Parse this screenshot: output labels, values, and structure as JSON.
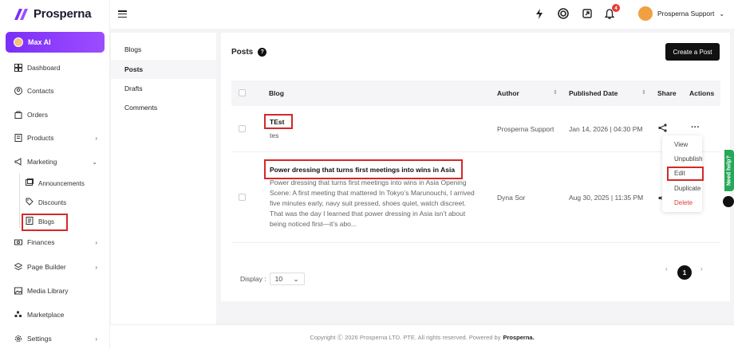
{
  "brand": {
    "name": "Prosperna",
    "accent": "#7b2ff7"
  },
  "sidebar": {
    "max_ai": "Max AI",
    "items": [
      {
        "label": "Dashboard",
        "icon": "dashboard-icon"
      },
      {
        "label": "Contacts",
        "icon": "contacts-icon"
      },
      {
        "label": "Orders",
        "icon": "orders-icon"
      },
      {
        "label": "Products",
        "icon": "products-icon"
      },
      {
        "label": "Marketing",
        "icon": "marketing-icon"
      },
      {
        "label": "Finances",
        "icon": "finances-icon"
      },
      {
        "label": "Page Builder",
        "icon": "page-builder-icon"
      },
      {
        "label": "Media Library",
        "icon": "media-library-icon"
      },
      {
        "label": "Marketplace",
        "icon": "marketplace-icon"
      },
      {
        "label": "Settings",
        "icon": "settings-icon"
      }
    ],
    "marketing_sub": [
      {
        "label": "Announcements"
      },
      {
        "label": "Discounts"
      },
      {
        "label": "Blogs"
      }
    ]
  },
  "topbar": {
    "notifications_count": "4",
    "user_name": "Prosperna Support"
  },
  "subnav": {
    "items": [
      "Blogs",
      "Posts",
      "Drafts",
      "Comments"
    ]
  },
  "posts": {
    "title": "Posts",
    "create_label": "Create a Post",
    "columns": {
      "blog": "Blog",
      "author": "Author",
      "published": "Published Date",
      "share": "Share",
      "actions": "Actions"
    },
    "rows": [
      {
        "title": "TEst",
        "excerpt": "tes",
        "author": "Prosperna Support",
        "date": "Jan 14, 2026 | 04:30 PM"
      },
      {
        "title": "Power dressing that turns first meetings into wins in Asia",
        "excerpt_lines": [
          "Power dressing that turns first meetings into wins in Asia Opening",
          "Scene: A first meeting that mattered In Tokyo’s Marunouchi, I arrived",
          "five minutes early, navy suit pressed, shoes quiet, watch discreet.",
          "That was the day I learned that power dressing in Asia isn’t about",
          "being noticed first—it’s abo..."
        ],
        "author": "Dyna Sor",
        "date": "Aug 30, 2025 | 11:35 PM"
      }
    ],
    "action_menu": [
      "View",
      "Unpublish",
      "Edit",
      "Duplicate",
      "Delete"
    ],
    "display_label": "Display :",
    "display_value": "10",
    "current_page": "1"
  },
  "footer": {
    "text": "Copyright Ⓒ 2026 Prosperna LTD. PTE. All rights reserved. Powered by",
    "brand": "Prosperna."
  },
  "widget": {
    "need_help": "Need help?"
  }
}
